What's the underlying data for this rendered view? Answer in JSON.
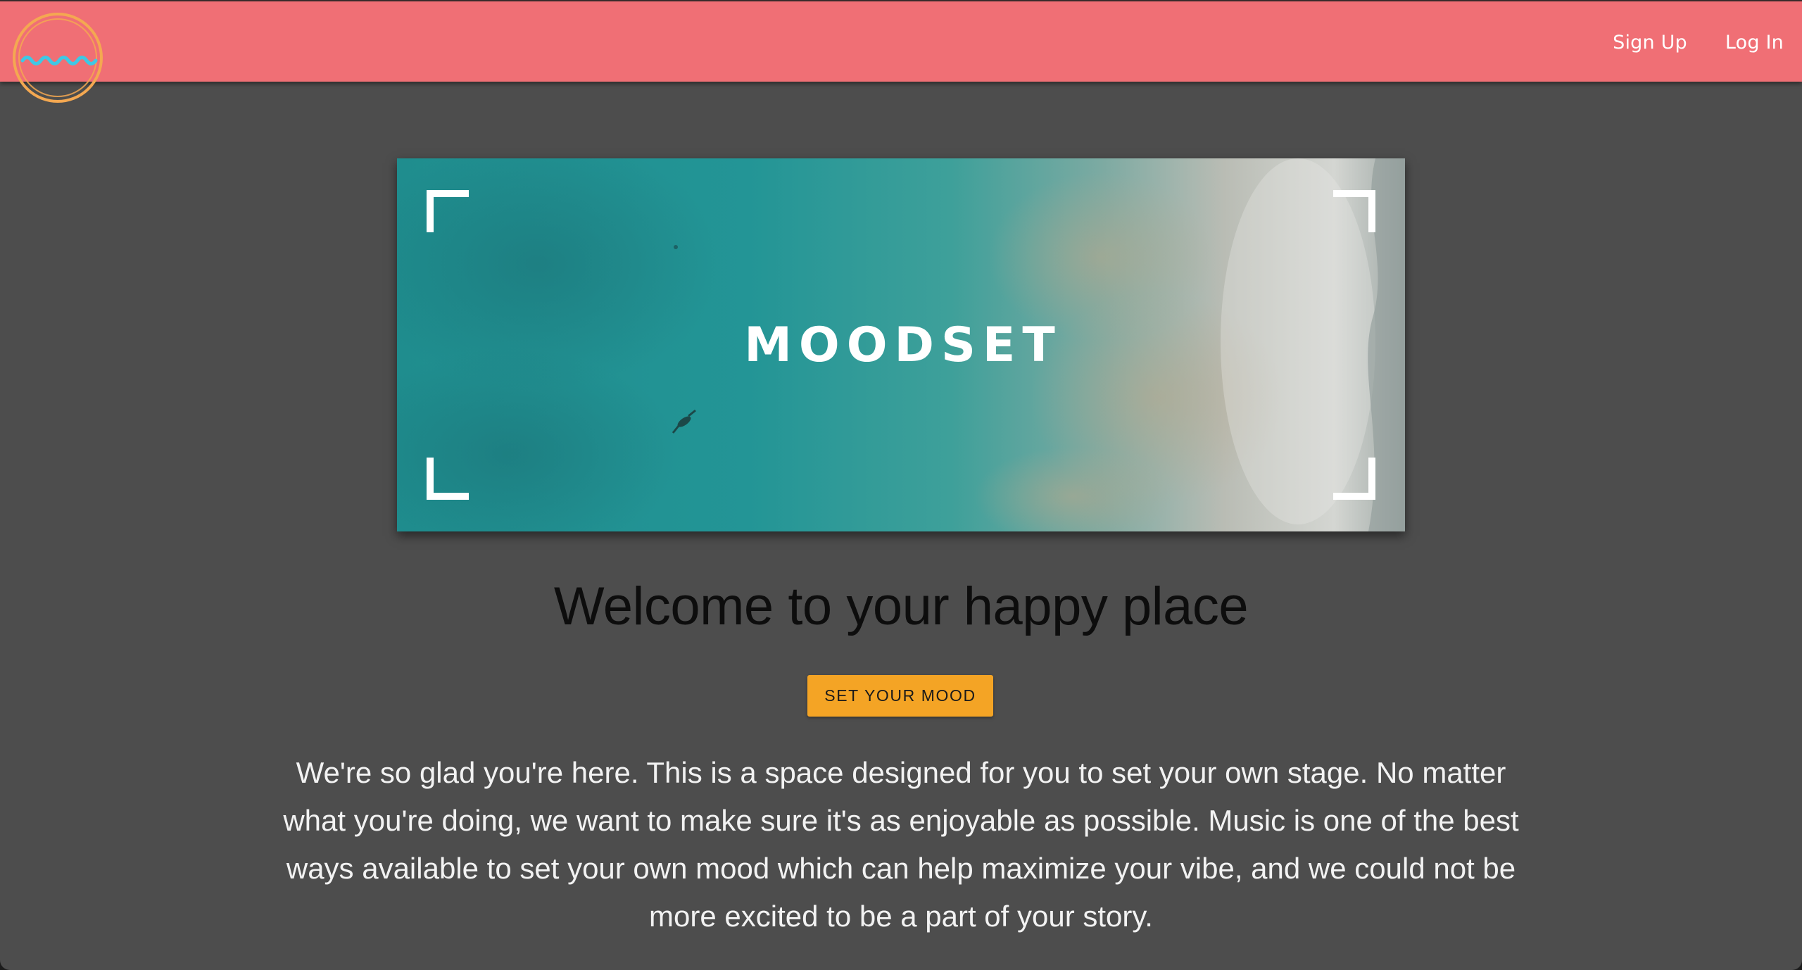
{
  "nav": {
    "logo_label": "Moodset logo",
    "signup_label": "Sign Up",
    "login_label": "Log In"
  },
  "banner": {
    "title": "MOODSET"
  },
  "main": {
    "headline": "Welcome to your happy place",
    "cta_label": "SET YOUR MOOD",
    "intro": "We're so glad you're here. This is a space designed for you to set your own stage. No matter what you're doing, we want to make sure it's as enjoyable as possible. Music is one of the best ways available to set your own mood which can help maximize your vibe, and we could not be more excited to be a part of your story."
  },
  "colors": {
    "navbar": "#f06f75",
    "background": "#4d4d4d",
    "logo_ring": "#f4a851",
    "logo_wave": "#3fc8e4",
    "cta": "#f4a425",
    "headline": "#0d0d0d",
    "body_text": "#f2f2f2"
  },
  "icons": {
    "logo": "wave-in-circle-icon",
    "banner_corners": "frame-corner-icon"
  }
}
